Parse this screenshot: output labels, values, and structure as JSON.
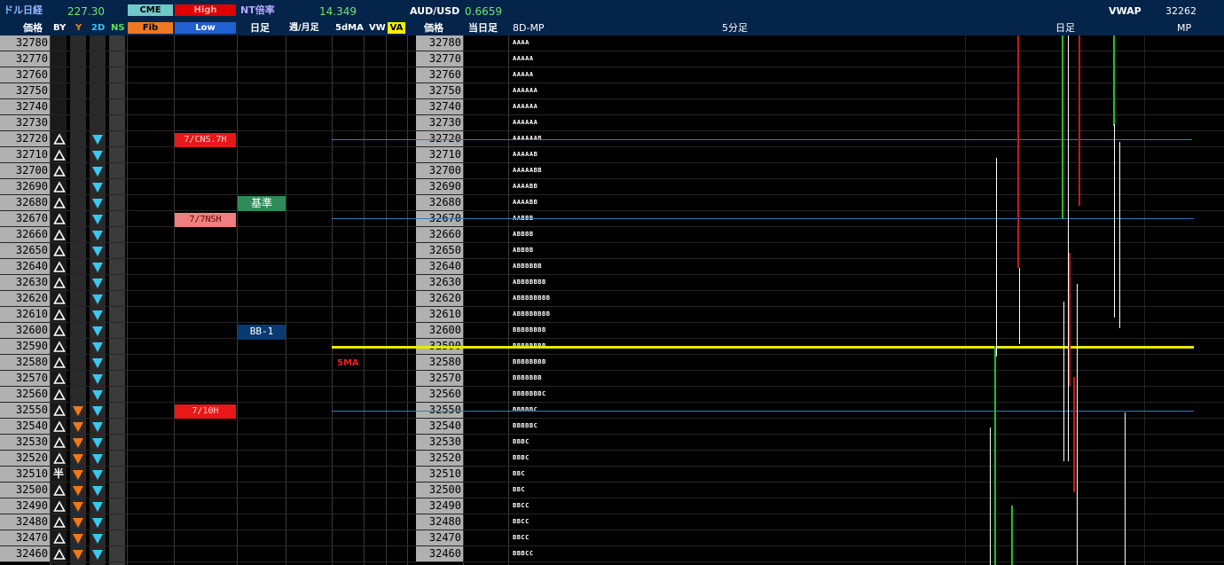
{
  "header": {
    "dollar_nikkei_label": "ドル日経",
    "dollar_nikkei_value": "227.30",
    "cme_label": "CME",
    "high_label": "High",
    "fib_label": "Fib",
    "low_label": "Low",
    "nt_ratio_label": "NT倍率",
    "nt_ratio_value": "14.349",
    "audusd_label": "AUD/USD",
    "audusd_value": "0.6659",
    "vwap_label": "VWAP",
    "vwap_value": "32262"
  },
  "columns": {
    "price": "価格",
    "by": "BY",
    "y": "Y",
    "twod": "2D",
    "ns": "NS",
    "daily": "日足",
    "weekly_monthly": "週/月足",
    "fivedma": "5dMA",
    "vw": "VW",
    "va": "VA",
    "price2": "価格",
    "today": "当日足",
    "mp8d": "8D-MP",
    "five_min": "5分足",
    "daily2": "日足",
    "mp": "MP"
  },
  "rows": [
    {
      "price": "32780",
      "mp": "AAAA"
    },
    {
      "price": "32770",
      "mp": "AAAAA"
    },
    {
      "price": "32760",
      "mp": "AAAAA"
    },
    {
      "price": "32750",
      "mp": "AAAAAA"
    },
    {
      "price": "32740",
      "mp": "AAAAAA"
    },
    {
      "price": "32730",
      "mp": "AAAAAA"
    },
    {
      "price": "32720",
      "mp": "AAAAAAB"
    },
    {
      "price": "32710",
      "mp": "AAAAAB"
    },
    {
      "price": "32700",
      "mp": "AAAAABB"
    },
    {
      "price": "32690",
      "mp": "AAAABB"
    },
    {
      "price": "32680",
      "mp": "AAAABB"
    },
    {
      "price": "32670",
      "mp": "AABBB"
    },
    {
      "price": "32660",
      "mp": "ABBBB"
    },
    {
      "price": "32650",
      "mp": "ABBBB"
    },
    {
      "price": "32640",
      "mp": "ABBBBBB"
    },
    {
      "price": "32630",
      "mp": "ABBBBBBB"
    },
    {
      "price": "32620",
      "mp": "ABBBBBBBB"
    },
    {
      "price": "32610",
      "mp": "ABBBBBBBB"
    },
    {
      "price": "32600",
      "mp": "BBBBBBBB"
    },
    {
      "price": "32590",
      "mp": "BBBBBBBB"
    },
    {
      "price": "32580",
      "mp": "BBBBBBBB"
    },
    {
      "price": "32570",
      "mp": "BBBBBBB"
    },
    {
      "price": "32560",
      "mp": "BBBBBBBC"
    },
    {
      "price": "32550",
      "mp": "BBBBBC"
    },
    {
      "price": "32540",
      "mp": "BBBBBC"
    },
    {
      "price": "32530",
      "mp": "BBBC"
    },
    {
      "price": "32520",
      "mp": "BBBC"
    },
    {
      "price": "32510",
      "mp": "BBC"
    },
    {
      "price": "32500",
      "mp": "BBC"
    },
    {
      "price": "32490",
      "mp": "BBCC"
    },
    {
      "price": "32480",
      "mp": "BBCC"
    },
    {
      "price": "32470",
      "mp": "BBCC"
    },
    {
      "price": "32460",
      "mp": "BBBCC"
    }
  ],
  "markers": {
    "half": "半",
    "tag_cns": "7/CNS.7H",
    "tag_nsh": "7/7NSH",
    "tag_10h": "7/10H",
    "tag_kijun": "基準",
    "tag_bb": "BB-1",
    "tag_5ma": "5MA"
  },
  "colors": {
    "header_bg": "#04244a",
    "green_value": "#6fe86f",
    "cme_bg": "#70c8c8",
    "high_bg": "#e00000",
    "fib_bg": "#f07820",
    "low_bg": "#2060d0",
    "tag_red": "#e81818",
    "tag_pink": "#f08080",
    "tag_green": "#2e8b57",
    "tag_blue": "#0a3a70",
    "yellow_line": "#e8e800",
    "blue_line": "#3a78b8"
  }
}
